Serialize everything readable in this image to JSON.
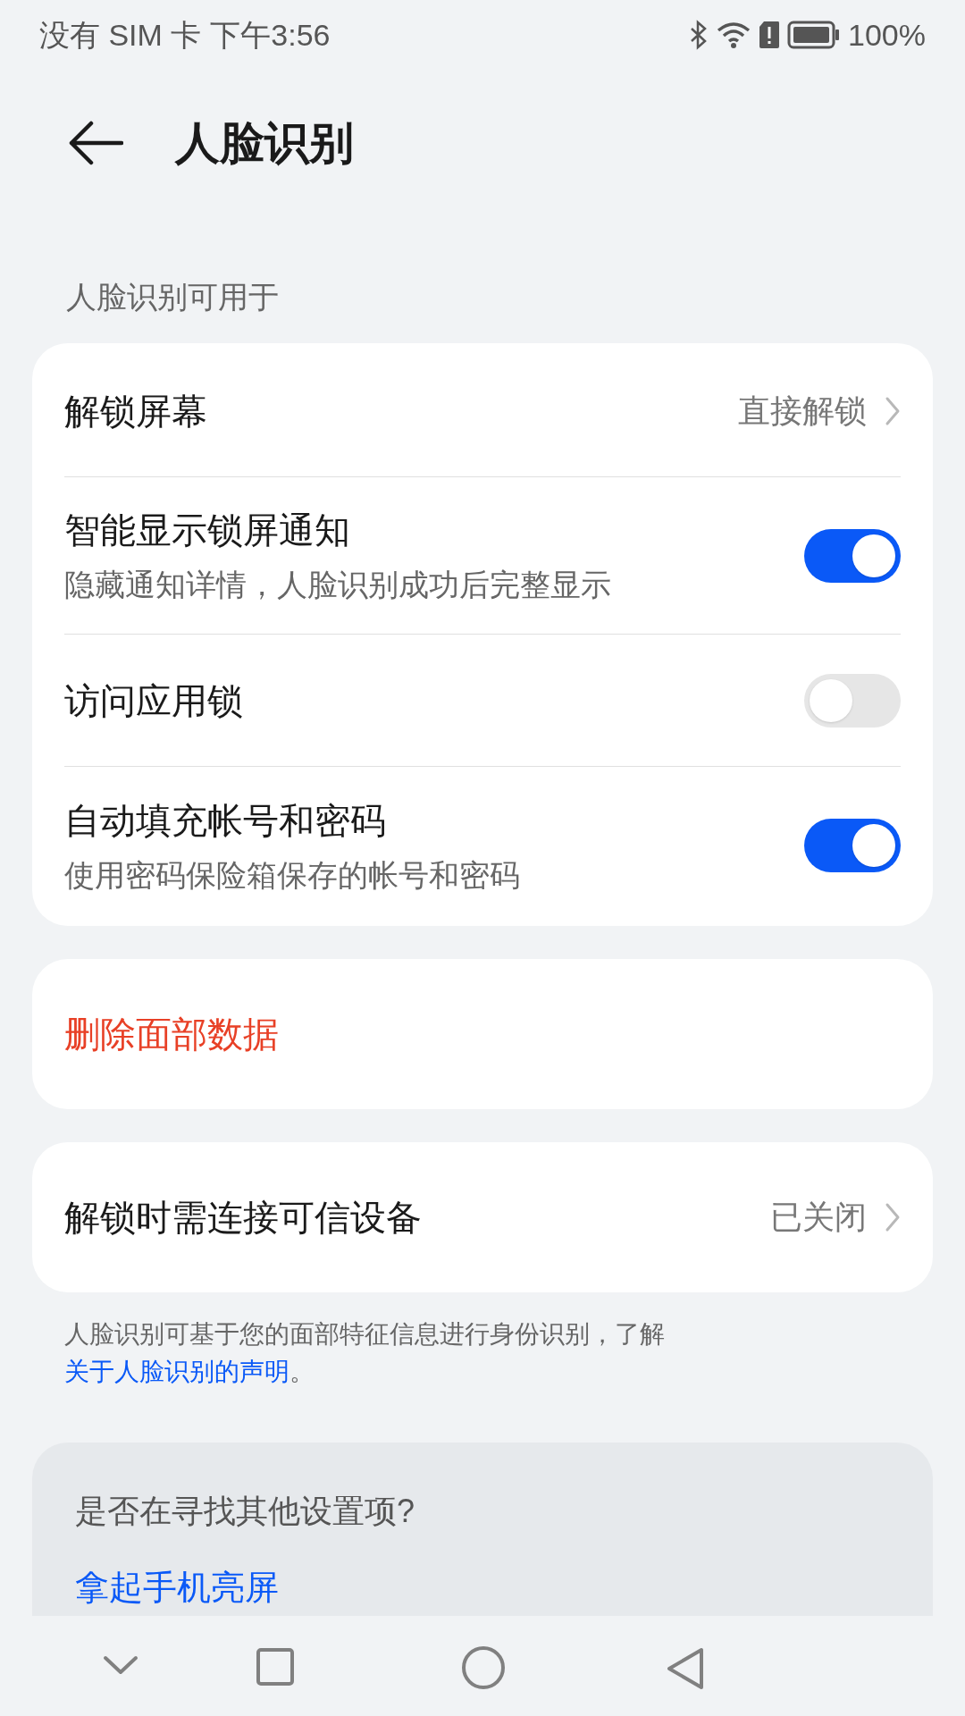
{
  "status_bar": {
    "carrier": "没有 SIM 卡",
    "time": "下午3:56",
    "battery": "100%"
  },
  "header": {
    "title": "人脸识别"
  },
  "section_label": "人脸识别可用于",
  "settings": [
    {
      "kind": "link",
      "title": "解锁屏幕",
      "value": "直接解锁"
    },
    {
      "kind": "toggle",
      "title": "智能显示锁屏通知",
      "subtitle": "隐藏通知详情，人脸识别成功后完整显示",
      "on": true
    },
    {
      "kind": "toggle",
      "title": "访问应用锁",
      "on": false
    },
    {
      "kind": "toggle",
      "title": "自动填充帐号和密码",
      "subtitle": "使用密码保险箱保存的帐号和密码",
      "on": true
    }
  ],
  "delete_button": "删除面部数据",
  "trusted_device": {
    "title": "解锁时需连接可信设备",
    "value": "已关闭"
  },
  "footnote": {
    "text": "人脸识别可基于您的面部特征信息进行身份识别，了解",
    "link": "关于人脸识别的声明",
    "end": "。"
  },
  "suggestions": {
    "question": "是否在寻找其他设置项?",
    "link": "拿起手机亮屏"
  }
}
